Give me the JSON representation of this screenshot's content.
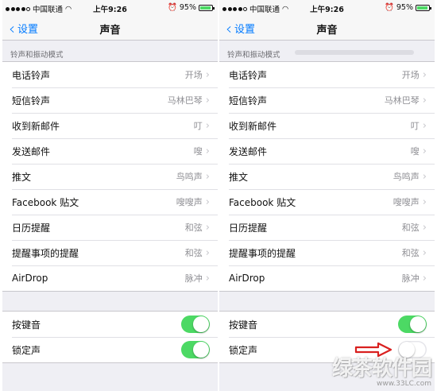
{
  "status_bar": {
    "carrier": "中国联通",
    "time": "上午9:26",
    "battery_percent": "95%",
    "battery_level": 0.95,
    "signal_bars_filled": 4
  },
  "nav": {
    "back_label": "设置",
    "title": "声音"
  },
  "section_header": "铃声和振动模式",
  "sound_rows": [
    {
      "label": "电话铃声",
      "value": "开场"
    },
    {
      "label": "短信铃声",
      "value": "马林巴琴"
    },
    {
      "label": "收到新邮件",
      "value": "叮"
    },
    {
      "label": "发送邮件",
      "value": "嗖"
    },
    {
      "label": "推文",
      "value": "鸟鸣声"
    },
    {
      "label": "Facebook 贴文",
      "value": "嗖嗖声"
    },
    {
      "label": "日历提醒",
      "value": "和弦"
    },
    {
      "label": "提醒事项的提醒",
      "value": "和弦"
    },
    {
      "label": "AirDrop",
      "value": "脉冲"
    }
  ],
  "toggles": {
    "keyboard_clicks": {
      "label": "按键音"
    },
    "lock_sound": {
      "label": "锁定声"
    }
  },
  "left_state": {
    "keyboard_clicks": true,
    "lock_sound": true
  },
  "right_state": {
    "keyboard_clicks": true,
    "lock_sound": false
  },
  "colors": {
    "ios_blue": "#007aff",
    "toggle_on": "#4cd964",
    "annotation_arrow": "#d9201f"
  },
  "watermark": {
    "text": "绿茶软件园",
    "url": "www.33LC.com"
  }
}
